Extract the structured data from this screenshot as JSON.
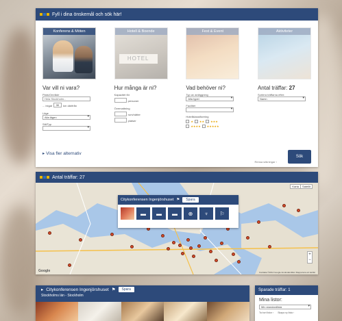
{
  "colors": {
    "navy": "#2d4a7a",
    "pin": "#d64a2a"
  },
  "search": {
    "header": "Fyll i dina önskemål och sök här!",
    "tiles": [
      {
        "label": "Konferens & Möten",
        "active": true
      },
      {
        "label": "Hotell & Boende",
        "active": false
      },
      {
        "label": "Fest & Event",
        "active": false
      },
      {
        "label": "Aktiviteter",
        "active": false
      }
    ],
    "where": {
      "title": "Var vill ni vara?",
      "place_label": "Plats/Område",
      "place_value": "Hela Stockholm...",
      "near_prefix": "... inigat",
      "near_value": "30",
      "near_suffix": "km därifrån",
      "area_label": "Läge",
      "area_value": "Alla lägen",
      "type_label": "Stil/Typ",
      "type_value": ""
    },
    "how_many": {
      "title": "Hur många är ni?",
      "capacity_label": "Kapacitet för",
      "capacity_unit": "personer",
      "overnight_label": "Övernattning",
      "rooms_unit": "rum/nätter",
      "nights_unit": "platser"
    },
    "needs": {
      "title": "Vad behöver ni?",
      "type_label": "Typ av anläggning",
      "type_value": "Alla typer",
      "price_label": "Facilitet",
      "price_value": "",
      "class_label": "Hotellklassificering"
    },
    "hits": {
      "title": "Antal träffar:",
      "count": "27",
      "sort_label": "Sortera träffarna efter:",
      "sort_value": "Namn"
    },
    "more_options": "▸ Visa fler alternativ",
    "search_button": "Sök",
    "reset_link": "Rensa sökningar  ›"
  },
  "map": {
    "header": "Antal träffar: 27",
    "toggle": [
      "Karta",
      "Satellit"
    ],
    "popup_title": "Citykonferensen Ingenjörshuset",
    "save_button": "Spara",
    "amenities": [
      "bed-icon",
      "bed-icon",
      "bed-icon",
      "food-icon",
      "toast-icon",
      "activity-icon"
    ],
    "footer": "Kartdata ©2014 Google  Användarvillkor  Rapportera ett kartfel",
    "google": "Google",
    "pins": [
      [
        0.05,
        0.55
      ],
      [
        0.16,
        0.62
      ],
      [
        0.27,
        0.56
      ],
      [
        0.34,
        0.7
      ],
      [
        0.4,
        0.5
      ],
      [
        0.45,
        0.58
      ],
      [
        0.47,
        0.72
      ],
      [
        0.49,
        0.65
      ],
      [
        0.51,
        0.68
      ],
      [
        0.52,
        0.77
      ],
      [
        0.54,
        0.62
      ],
      [
        0.55,
        0.71
      ],
      [
        0.56,
        0.8
      ],
      [
        0.58,
        0.69
      ],
      [
        0.6,
        0.6
      ],
      [
        0.62,
        0.75
      ],
      [
        0.64,
        0.85
      ],
      [
        0.66,
        0.66
      ],
      [
        0.68,
        0.5
      ],
      [
        0.7,
        0.78
      ],
      [
        0.72,
        0.86
      ],
      [
        0.75,
        0.6
      ],
      [
        0.79,
        0.43
      ],
      [
        0.83,
        0.7
      ],
      [
        0.88,
        0.25
      ],
      [
        0.93,
        0.3
      ],
      [
        0.12,
        0.9
      ]
    ]
  },
  "result": {
    "title": "Citykonferensen Ingenjörshuset",
    "save_button": "Spara",
    "subtitle": "Stockholms län - Stockholm"
  },
  "saved": {
    "header": "Sparade träffar: 1",
    "list_title": "Mina listor:",
    "list_value": "Min standardlista",
    "link_1": "Ta bort listor ›",
    "link_2": "Skapa ny lista ›"
  }
}
